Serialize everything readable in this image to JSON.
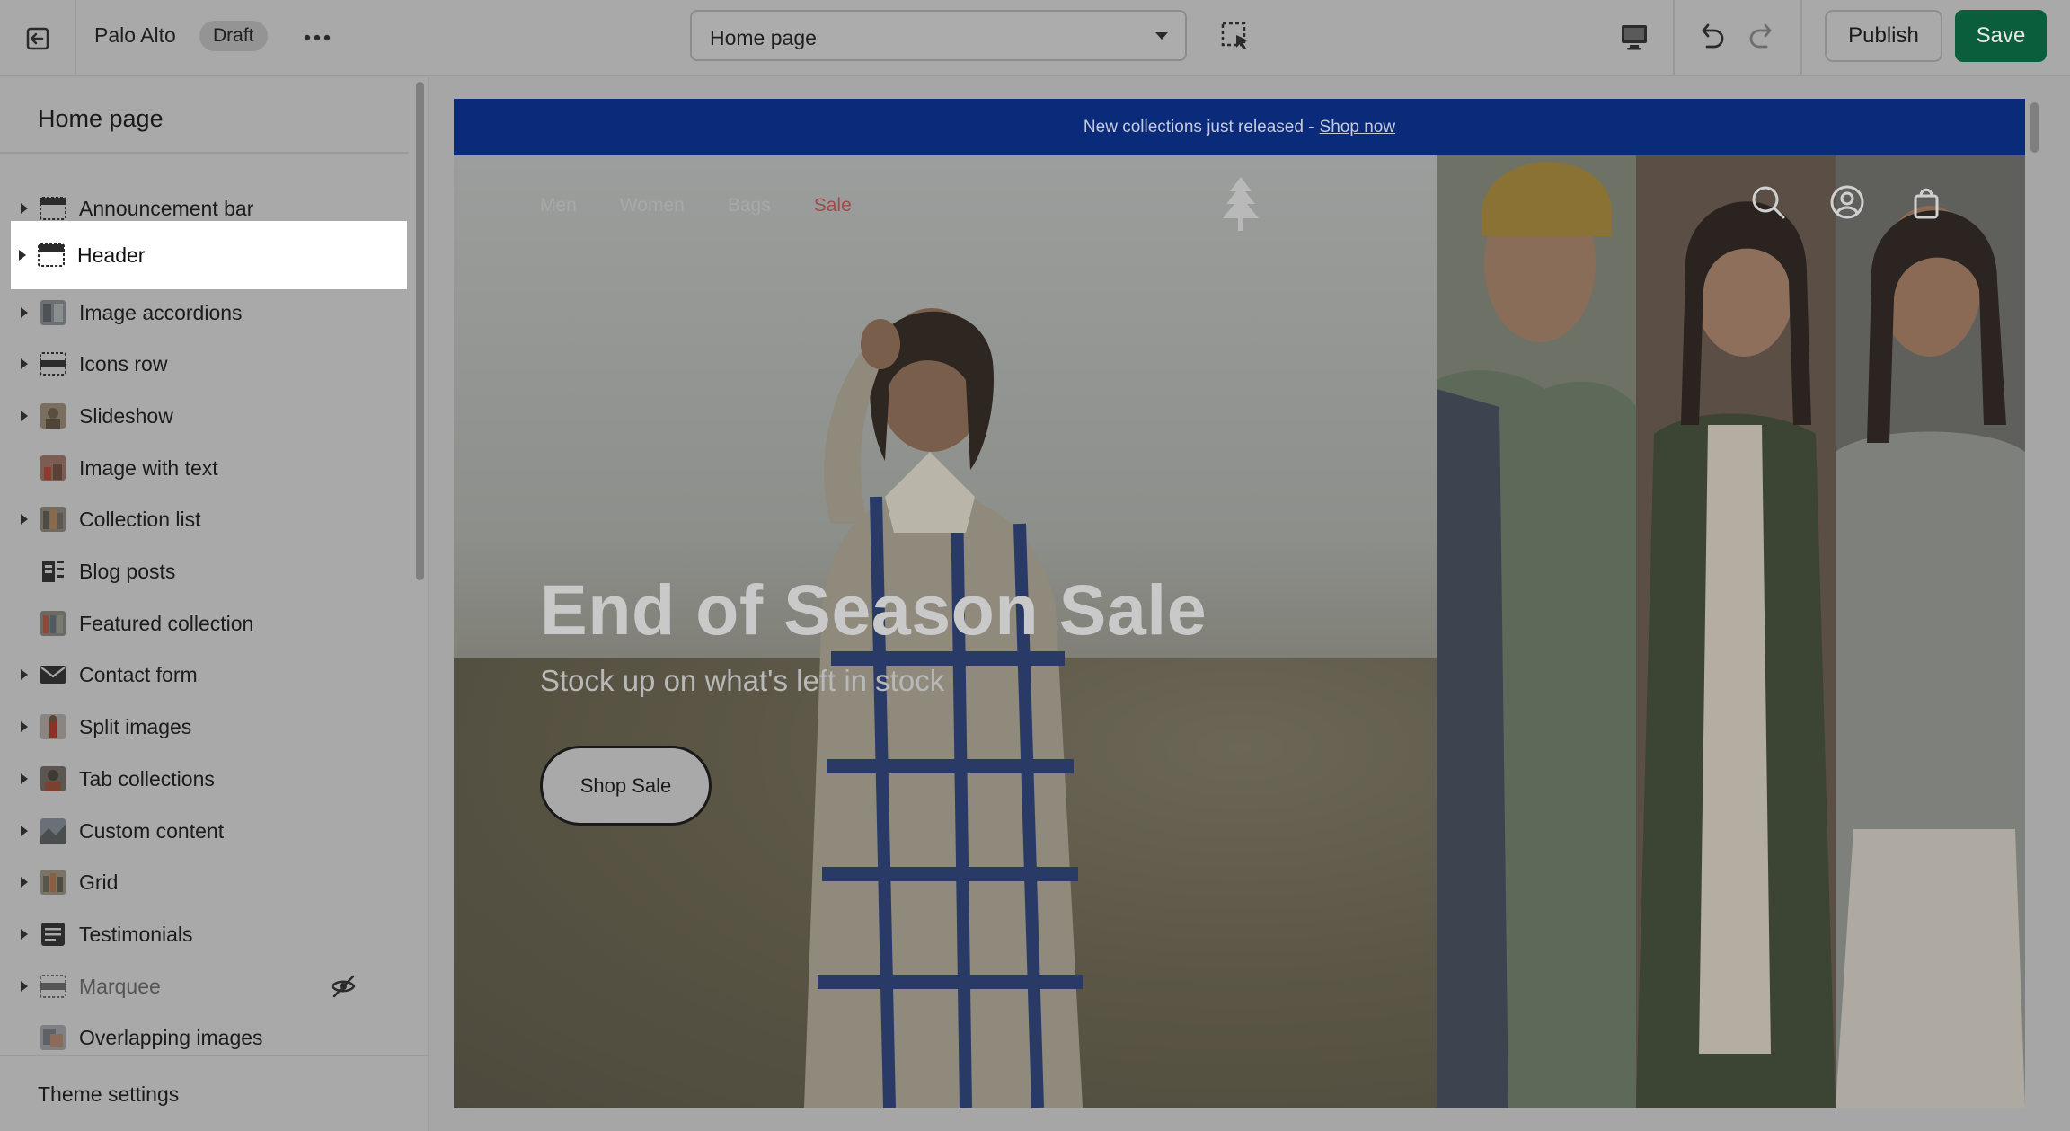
{
  "topbar": {
    "exit_icon": "exit-icon",
    "store_name": "Palo Alto",
    "status_badge": "Draft",
    "more_icon": "more-horizontal-icon",
    "page_select_value": "Home page",
    "publish_label": "Publish",
    "save_label": "Save"
  },
  "sidebar": {
    "title": "Home page",
    "items": [
      {
        "label": "Announcement bar",
        "expandable": true,
        "icon": "section-icon"
      },
      {
        "label": "Header",
        "expandable": true,
        "icon": "section-icon"
      },
      {
        "label": "Image accordions",
        "expandable": true,
        "icon": "image-thumb"
      },
      {
        "label": "Icons row",
        "expandable": true,
        "icon": "section-icon"
      },
      {
        "label": "Slideshow",
        "expandable": true,
        "icon": "image-thumb"
      },
      {
        "label": "Image with text",
        "expandable": false,
        "icon": "image-thumb"
      },
      {
        "label": "Collection list",
        "expandable": true,
        "icon": "image-thumb"
      },
      {
        "label": "Blog posts",
        "expandable": false,
        "icon": "blog-icon"
      },
      {
        "label": "Featured collection",
        "expandable": false,
        "icon": "image-thumb"
      },
      {
        "label": "Contact form",
        "expandable": true,
        "icon": "mail-icon"
      },
      {
        "label": "Split images",
        "expandable": true,
        "icon": "image-thumb"
      },
      {
        "label": "Tab collections",
        "expandable": true,
        "icon": "image-thumb"
      },
      {
        "label": "Custom content",
        "expandable": true,
        "icon": "image-thumb"
      },
      {
        "label": "Grid",
        "expandable": true,
        "icon": "image-thumb"
      },
      {
        "label": "Testimonials",
        "expandable": true,
        "icon": "text-icon"
      },
      {
        "label": "Marquee",
        "expandable": true,
        "icon": "section-icon"
      },
      {
        "label": "Overlapping images",
        "expandable": false,
        "icon": "image-thumb"
      }
    ],
    "footer_label": "Theme settings"
  },
  "preview": {
    "announcement_text": "New collections just released -",
    "announcement_link": "Shop now",
    "nav": {
      "men": "Men",
      "women": "Women",
      "bags": "Bags",
      "sale": "Sale"
    },
    "hero_title": "End of Season Sale",
    "hero_subtitle": "Stock up on what's left in stock",
    "hero_button": "Shop Sale"
  },
  "colors": {
    "save_button": "#0b5e3c",
    "announcement_bg": "#0a2a7a",
    "overlay": "#a9a9a9"
  }
}
